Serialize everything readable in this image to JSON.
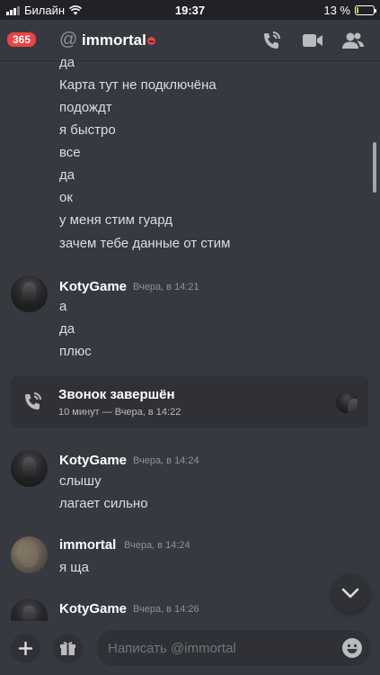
{
  "status_bar": {
    "carrier": "Билайн",
    "time": "19:37",
    "battery_percent": "13 %",
    "battery_level": 0.13,
    "battery_color": "#f0c419"
  },
  "header": {
    "unread_count": "365",
    "channel_name": "immortal",
    "at_symbol": "@",
    "status": "dnd"
  },
  "messages_top": [
    "да",
    "Карта тут не подключёна",
    "подождт",
    "я быстро",
    "все",
    "да",
    "ок",
    "у меня стим гуард",
    "зачем тебе данные от стим"
  ],
  "groups": [
    {
      "author": "KotyGame",
      "timestamp": "Вчера, в 14:21",
      "lines": [
        "а",
        "да",
        "плюс"
      ]
    },
    {
      "author": "KotyGame",
      "timestamp": "Вчера, в 14:24",
      "lines": [
        "слышу",
        "лагает сильно"
      ]
    },
    {
      "author": "immortal",
      "timestamp": "Вчера, в 14:24",
      "lines": [
        "я ща"
      ]
    },
    {
      "author": "KotyGame",
      "timestamp": "Вчера, в 14:26",
      "lines": []
    }
  ],
  "call": {
    "title": "Звонок завершён",
    "subtitle": "10 минут — Вчера, в 14:22"
  },
  "composer": {
    "placeholder": "Написать @immortal"
  },
  "colors": {
    "background": "#36393f",
    "secondary": "#2f3136",
    "danger": "#ed4245",
    "text": "#dcddde",
    "muted": "#8e9297"
  },
  "icons": [
    "menu-icon",
    "phone-call-icon",
    "video-camera-icon",
    "members-icon",
    "call-ended-icon",
    "chevron-down-icon",
    "plus-icon",
    "gift-icon",
    "emoji-icon"
  ]
}
